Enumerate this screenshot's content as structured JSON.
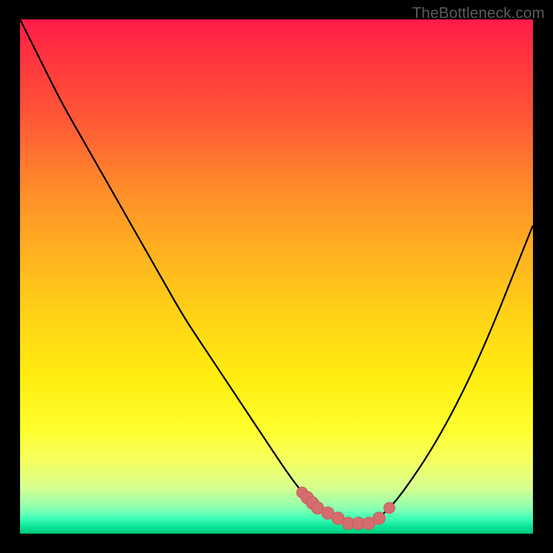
{
  "watermark": "TheBottleneck.com",
  "colors": {
    "background_black": "#000000",
    "gradient_top": "#ff1a4a",
    "gradient_bottom": "#00c878",
    "curve_stroke": "#000000",
    "marker_fill": "#d46d6d",
    "marker_stroke": "#c95b5b"
  },
  "chart_data": {
    "type": "line",
    "title": "",
    "xlabel": "",
    "ylabel": "",
    "xlim": [
      0,
      100
    ],
    "ylim": [
      0,
      100
    ],
    "grid": false,
    "legend": false,
    "series": [
      {
        "name": "bottleneck-percent",
        "x": [
          0,
          4,
          8,
          12,
          16,
          20,
          24,
          28,
          32,
          36,
          40,
          44,
          48,
          52,
          55,
          58,
          61,
          64,
          67,
          70,
          73,
          76,
          80,
          84,
          88,
          92,
          96,
          100
        ],
        "y": [
          100,
          92,
          84,
          77,
          70,
          63,
          56,
          49,
          42,
          36,
          30,
          24,
          18,
          12,
          8,
          5,
          3,
          2,
          2,
          3,
          6,
          10,
          16,
          23,
          31,
          40,
          50,
          60
        ]
      }
    ],
    "markers": {
      "name": "highlighted-region",
      "x": [
        55,
        56,
        57,
        58,
        60,
        62,
        64,
        66,
        68,
        70,
        72
      ],
      "y": [
        8,
        7,
        6,
        5,
        4,
        3,
        2,
        2,
        2,
        3,
        5
      ]
    }
  }
}
